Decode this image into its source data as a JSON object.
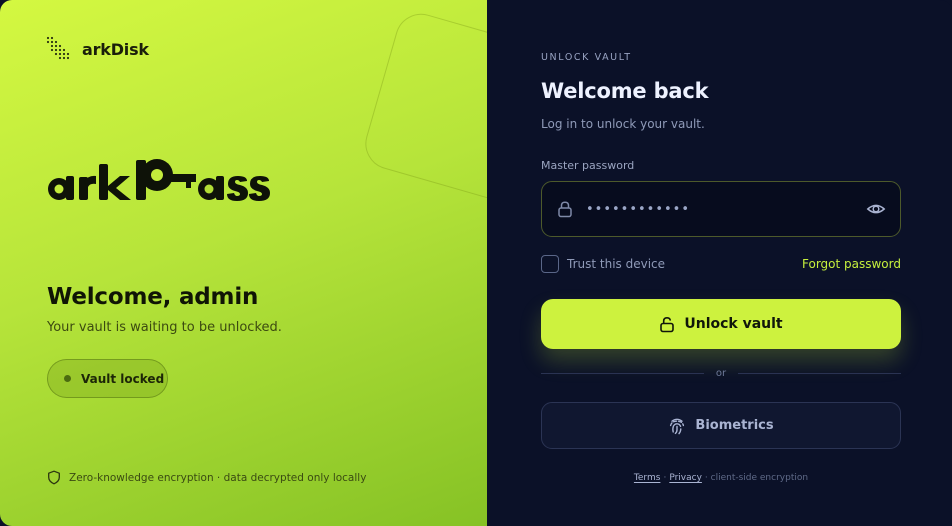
{
  "brand": {
    "name": "arkDisk",
    "icon": "dotted-grid-icon"
  },
  "product": {
    "logo_text": "arkPass"
  },
  "welcome": {
    "title": "Welcome, admin",
    "subtitle": "Your vault is waiting to be unlocked.",
    "status": "Vault locked"
  },
  "footnote": "Zero-knowledge encryption · data decrypted only locally",
  "form": {
    "eyebrow": "UNLOCK VAULT",
    "title": "Welcome back",
    "subtitle": "Log in to unlock your vault.",
    "password_label": "Master password",
    "password_value": "••••••••••••",
    "trust_label": "Trust this device",
    "trust_checked": false,
    "forgot_label": "Forgot password",
    "unlock_label": "Unlock vault",
    "or_label": "or",
    "biometrics_label": "Biometrics"
  },
  "legal": {
    "terms": "Terms",
    "separator": "·",
    "privacy": "Privacy",
    "note": "· client-side encryption"
  },
  "colors": {
    "accent": "#cdf23e",
    "panel_dark": "#0b1128",
    "panel_light_start": "#d4f841",
    "panel_light_end": "#86c225"
  }
}
